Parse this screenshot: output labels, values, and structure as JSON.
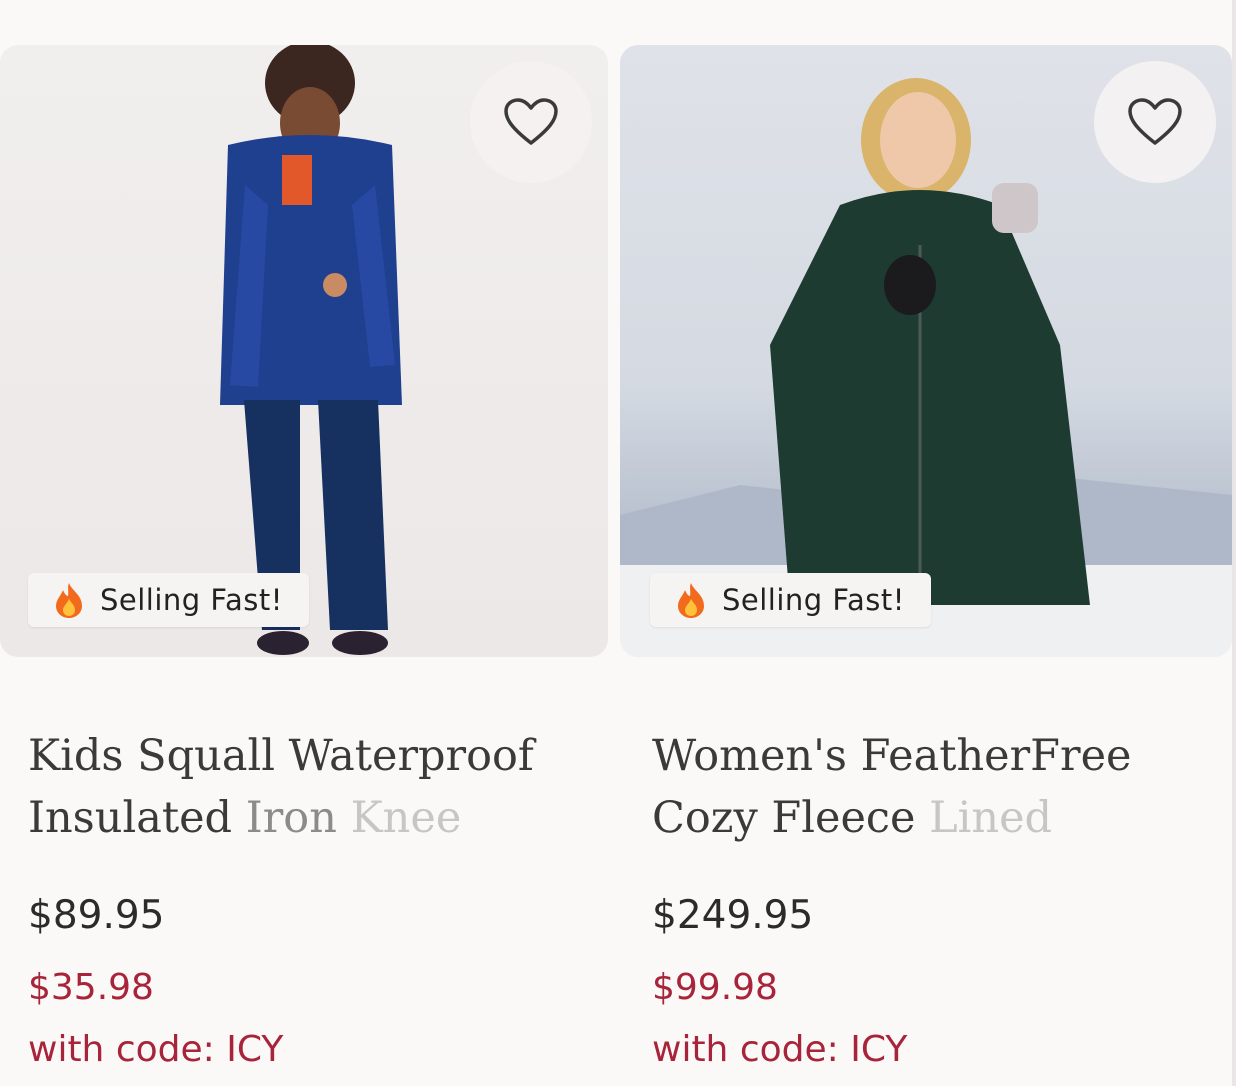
{
  "products": [
    {
      "badge": "Selling Fast!",
      "title_line1": "Kids Squall Waterproof",
      "title_line2_a": "Insulated ",
      "title_line2_b": "Iron ",
      "title_line2_c": "Knee",
      "price_original": "$89.95",
      "price_sale": "$35.98",
      "promo": "with code: ICY",
      "badge_icon": "fire-icon",
      "favorite_icon": "heart-icon"
    },
    {
      "badge": "Selling Fast!",
      "title_line1": "Women's FeatherFree",
      "title_line2_a": "Cozy Fleece ",
      "title_line2_b": "Lined",
      "title_line2_c": "",
      "price_original": "$249.95",
      "price_sale": "$99.98",
      "promo": "with code: ICY",
      "badge_icon": "fire-icon",
      "favorite_icon": "heart-icon"
    }
  ],
  "colors": {
    "sale_price": "#a8243a",
    "badge_bg": "#f6f4f3",
    "page_bg": "#fbf9f8"
  }
}
